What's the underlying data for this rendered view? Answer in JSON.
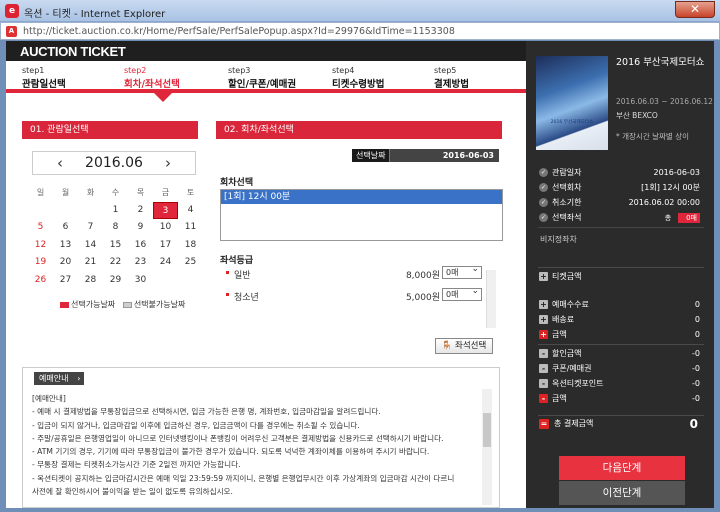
{
  "window": {
    "title": "옥션 - 티켓 - Internet Explorer",
    "close_glyph": "✕",
    "url": "http://ticket.auction.co.kr/Home/PerfSale/PerfSalePopup.aspx?Id=29976&IdTime=1153308"
  },
  "header": {
    "logo": "AUCTION TICKET"
  },
  "steps": [
    {
      "num": "step1",
      "label": "관람일선택",
      "active": false
    },
    {
      "num": "step2",
      "label": "회차/좌석선택",
      "active": true
    },
    {
      "num": "step3",
      "label": "할인/쿠폰/예매권",
      "active": false
    },
    {
      "num": "step4",
      "label": "티켓수령방법",
      "active": false
    },
    {
      "num": "step5",
      "label": "결제방법",
      "active": false
    }
  ],
  "panel1": {
    "title": "01. 관람일선택",
    "prev": "‹",
    "next": "›",
    "month": "2016.06",
    "weekdays": [
      "일",
      "월",
      "화",
      "수",
      "목",
      "금",
      "토"
    ],
    "weeks": [
      [
        "",
        "",
        "",
        "1",
        "2",
        "3",
        "4"
      ],
      [
        "5",
        "6",
        "7",
        "8",
        "9",
        "10",
        "11"
      ],
      [
        "12",
        "13",
        "14",
        "15",
        "16",
        "17",
        "18"
      ],
      [
        "19",
        "20",
        "21",
        "22",
        "23",
        "24",
        "25"
      ],
      [
        "26",
        "27",
        "28",
        "29",
        "30",
        "",
        ""
      ]
    ],
    "selected_day": "3",
    "legend_selectable": "선택가능날짜",
    "legend_unavailable": "선택불가능날짜",
    "color_selectable": "#e0263a",
    "color_unavailable": "#cfcfcf"
  },
  "panel2": {
    "title": "02. 회차/좌석선택",
    "date_label": "선택날짜",
    "date_value": "2016-06-03",
    "round_title": "회차선택",
    "round_option": "[1회] 12시 00분",
    "grade_title": "좌석등급",
    "grades": [
      {
        "name": "일반",
        "price": "8,000원",
        "qty": "0매"
      },
      {
        "name": "청소년",
        "price": "5,000원",
        "qty": "0매"
      }
    ],
    "seat_button_icon": "🪑",
    "seat_button": "좌석선택"
  },
  "notice": {
    "tab": "예매안내",
    "lines": [
      "[예매안내]",
      "- 예매 시 결제방법을 무통장입금으로 선택하시면, 입금 가능한 은행 명, 계좌번호, 입금마감일을 알려드립니다.",
      "- 입금이 되지 않거나, 입금마감일 이후에 입금하신 경우, 입금금액이 다를 경우에는 취소될 수 있습니다.",
      "- 주말/공휴일은 은행영업일이 아니므로 인터넷뱅킹이나 폰뱅킹이 어려우신 고객분은 결제방법을 신용카드로 선택하시기 바랍니다.",
      "- ATM 기기의 경우, 기기에 따라 무통장입금이 불가한 경우가 있습니다. 되도록 넉넉한 계좌이체를 이용하여 주시기 바랍니다.",
      "- 무통장 결제는 티켓취소가능시간 기준 2일전 까지만 가능합니다.",
      "- 옥션티켓이 공지하는 입금마감시간은 예매 익일 23:59:59 까지이니, 은행별 은행업무시간 이후 가상계좌의 입금마감 시간이 다르니",
      "  사전에 잘 확인하시어 불이익을 받는 일이 없도록 유의하십시오."
    ]
  },
  "sidebar": {
    "show_title": "2016 부산국제모터쇼",
    "poster_text": "2016 부산국제모터쇼",
    "date_range": "2016.06.03 ~ 2016.06.12",
    "venue": "부산 BEXCO",
    "note": "* 개장시간 날짜별 상이",
    "summary": [
      {
        "icon": "check-circle-icon",
        "glyph": "✓",
        "label": "관람일자",
        "value": "2016-06-03"
      },
      {
        "icon": "check-circle-icon",
        "glyph": "✓",
        "label": "선택회차",
        "value": "[1회] 12시 00분"
      },
      {
        "icon": "check-circle-icon",
        "glyph": "✓",
        "label": "취소기한",
        "value": "2016.06.02 00:00"
      },
      {
        "icon": "check-circle-icon",
        "glyph": "✓",
        "label": "선택좌석",
        "value": ""
      }
    ],
    "toggle_off": "총",
    "toggle_on": "0매",
    "seat_grade_info": "비지정좌차",
    "price_rows": [
      {
        "sign": "+",
        "label": "티켓금액",
        "value": "",
        "red": false
      },
      {
        "sign": "+",
        "label": "예매수수료",
        "value": "0",
        "red": false
      },
      {
        "sign": "+",
        "label": "배송료",
        "value": "0",
        "red": false
      },
      {
        "sign": "+",
        "label": "금액",
        "value": "0",
        "red": true
      },
      {
        "sign": "-",
        "label": "할인금액",
        "value": "-0",
        "red": false
      },
      {
        "sign": "-",
        "label": "쿠폰/예매권",
        "value": "-0",
        "red": false
      },
      {
        "sign": "-",
        "label": "옥션티켓포인트",
        "value": "-0",
        "red": false
      },
      {
        "sign": "-",
        "label": "금액",
        "value": "-0",
        "red": true
      }
    ],
    "total_sign": "=",
    "total_label": "총 결제금액",
    "total_value": "0",
    "next_button": "다음단계",
    "prev_button": "이전단계"
  }
}
